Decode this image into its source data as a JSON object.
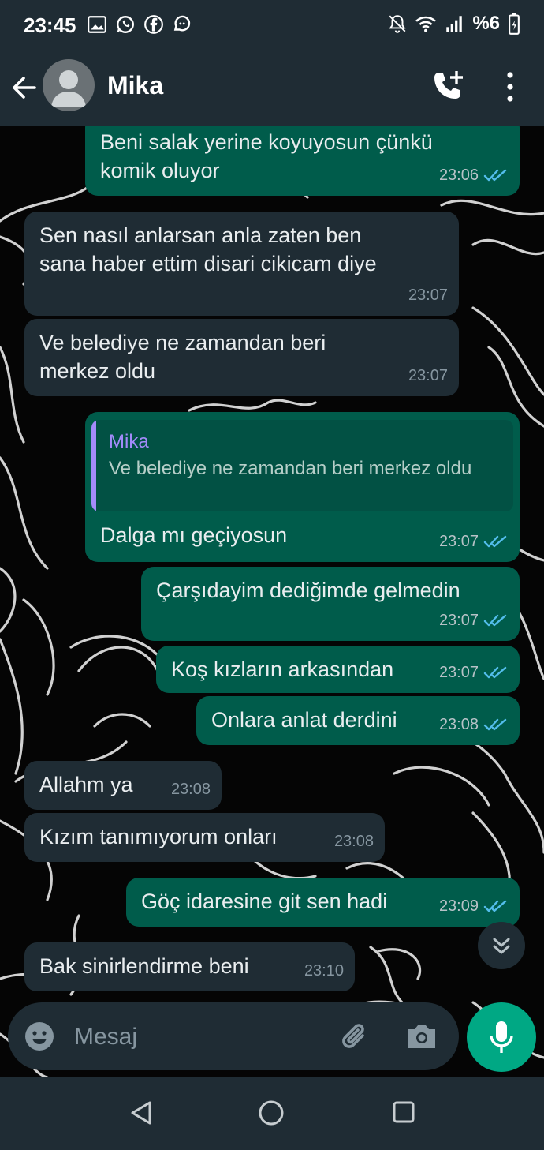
{
  "status_bar": {
    "time": "23:45",
    "left_icons": [
      "gallery-icon",
      "whatsapp-icon",
      "facebook-icon",
      "chat-bubble-icon"
    ],
    "right_icons": [
      "alarm-off-icon",
      "wifi-icon",
      "signal-icon",
      "battery-icon"
    ],
    "battery": "%6"
  },
  "header": {
    "contact_name": "Mika",
    "icons": [
      "back-arrow-icon",
      "avatar-icon",
      "add-call-icon",
      "more-vert-icon"
    ]
  },
  "messages": [
    {
      "direction": "out",
      "text": "Beni salak yerine koyuyosun çünkü\nkomik oluyor",
      "time": "23:06",
      "read": true
    },
    {
      "direction": "in",
      "text": "Sen nasıl anlarsan anla zaten ben\nsana haber ettim disari cikicam diye",
      "time": "23:07"
    },
    {
      "direction": "in",
      "text": "Ve belediye ne zamandan beri\nmerkez oldu",
      "time": "23:07"
    },
    {
      "direction": "out",
      "quote_author": "Mika",
      "quote_text": "Ve belediye ne zamandan beri merkez oldu",
      "text": "Dalga mı geçiyosun",
      "time": "23:07",
      "read": true
    },
    {
      "direction": "out",
      "text": "Çarşıdayim dediğimde gelmedin",
      "time": "23:07",
      "read": true
    },
    {
      "direction": "out",
      "text": "Koş kızların arkasından",
      "time": "23:07",
      "read": true
    },
    {
      "direction": "out",
      "text": "Onlara anlat derdini",
      "time": "23:08",
      "read": true
    },
    {
      "direction": "in",
      "text": "Allahm ya",
      "time": "23:08"
    },
    {
      "direction": "in",
      "text": "Kızım tanımıyorum onları",
      "time": "23:08"
    },
    {
      "direction": "out",
      "text": "Göç idaresine git sen hadi",
      "time": "23:09",
      "read": true
    },
    {
      "direction": "in",
      "text": "Bak sinirlendirme beni",
      "time": "23:10"
    }
  ],
  "composer": {
    "placeholder": "Mesaj",
    "icons": [
      "emoji-icon",
      "attach-icon",
      "camera-icon",
      "mic-icon",
      "scroll-down-icon"
    ]
  },
  "nav_bar": {
    "icons": [
      "nav-back-icon",
      "nav-home-icon",
      "nav-recents-icon"
    ]
  },
  "colors": {
    "header_bg": "#1f2c34",
    "outgoing_bubble": "#005c4b",
    "incoming_bubble": "#1f2c34",
    "accent": "#00a884",
    "read_ticks": "#53bdeb",
    "quote_author": "#a38bfa"
  }
}
